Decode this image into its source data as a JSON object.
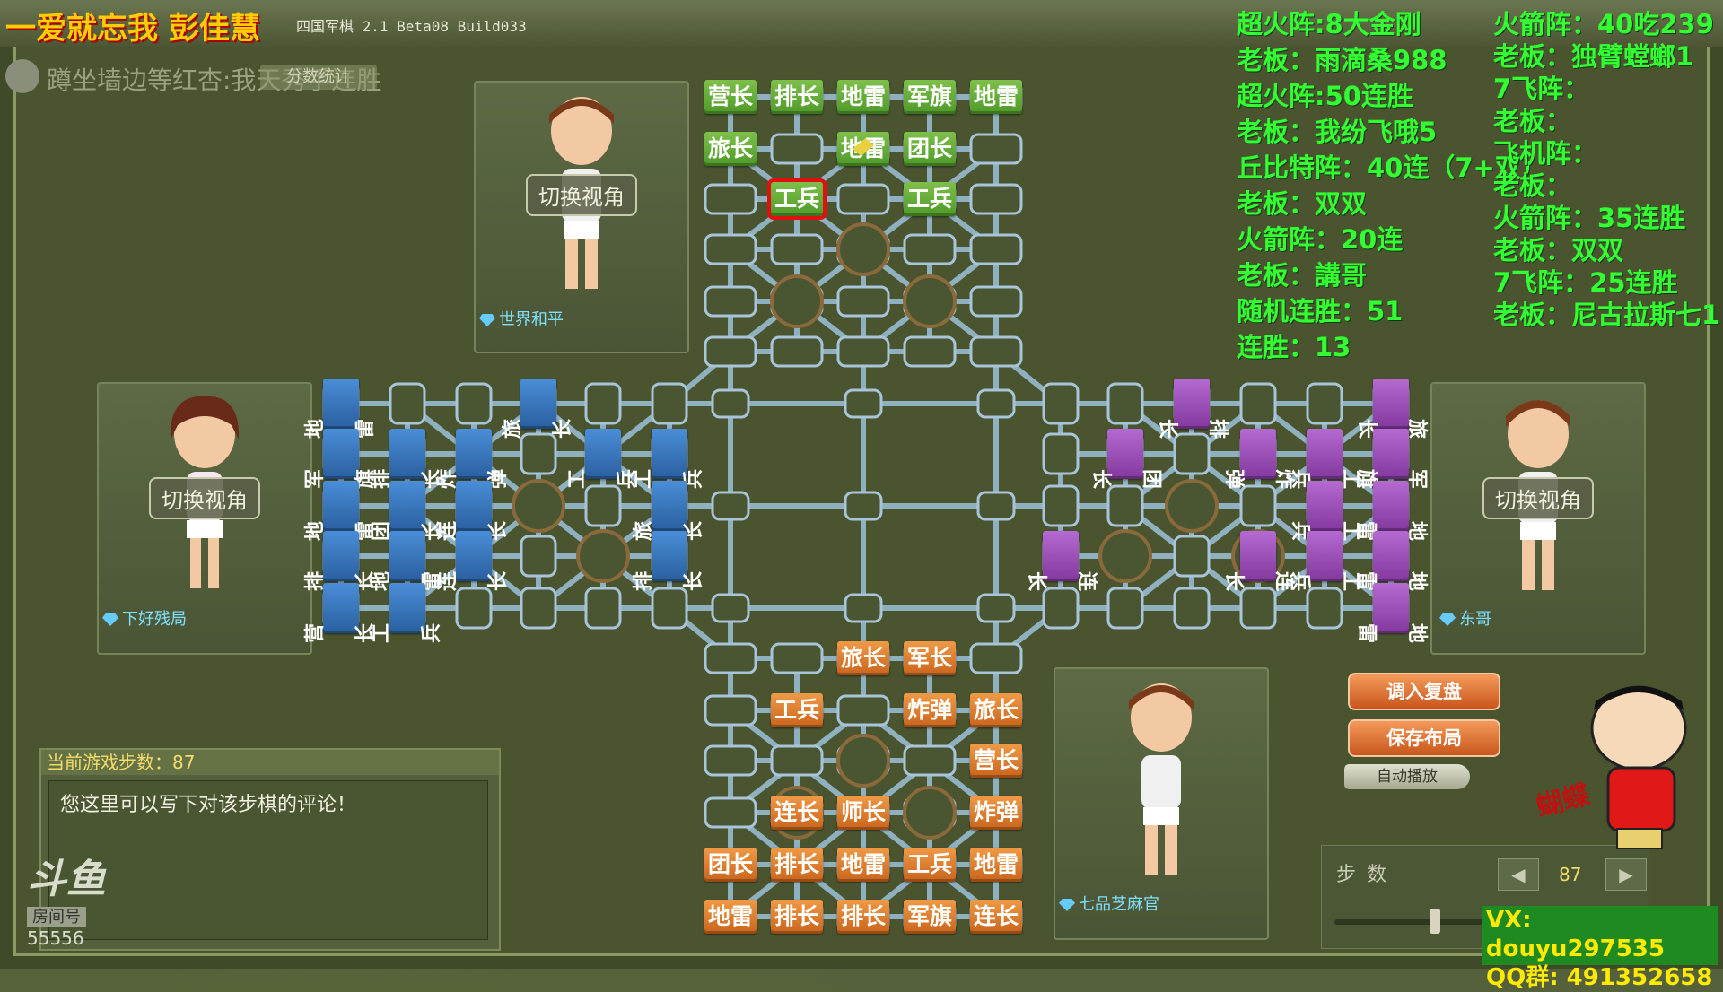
{
  "window": {
    "title": "四国军棋 2.1 Beta08 Build033",
    "overlay_name": "一爱就忘我 彭佳慧",
    "overlay_sub": "蹲坐墙边等红杏:我天秀手连胜",
    "ghost_button": "分数统计"
  },
  "players": {
    "top": {
      "name": "世界和平",
      "switch_label": "切换视角"
    },
    "left": {
      "name": "下好残局",
      "switch_label": "切换视角"
    },
    "right": {
      "name": "东哥",
      "switch_label": "切换视角"
    },
    "bottom": {
      "name": "七品芝麻官"
    }
  },
  "board": {
    "top_pieces": [
      "营长",
      "排长",
      "地雷",
      "军旗",
      "地雷",
      "旅长",
      "",
      "地雷",
      "团长",
      "",
      "工兵",
      "",
      "工兵",
      ""
    ],
    "top_highlight": "工兵",
    "left_pieces": [
      "地雷",
      "军旗",
      "地雷",
      "排长",
      "营长",
      "排长",
      "团长",
      "地雷",
      "工兵",
      "炸弹",
      "连长",
      "连长",
      "旅长",
      "工兵",
      "工兵",
      "旅长",
      "排长"
    ],
    "right_pieces": [
      "排长",
      "旅长",
      "团长",
      "炸弹",
      "工兵",
      "军旗",
      "工兵",
      "地雷",
      "连长",
      "连长",
      "工兵",
      "地雷",
      "地雷"
    ],
    "bottom_pieces": [
      "旅长",
      "军长",
      "工兵",
      "炸弹",
      "旅长",
      "营长",
      "连长",
      "师长",
      "炸弹",
      "团长",
      "排长",
      "地雷",
      "工兵",
      "地雷",
      "地雷",
      "排长",
      "排长",
      "军旗",
      "连长"
    ]
  },
  "info_left": [
    "超火阵:8大金刚",
    "老板：雨滴桑988",
    "超火阵:50连胜",
    "老板：我纷飞哦5",
    "丘比特阵：40连（7+双）",
    "老板：双双",
    "火箭阵：20连",
    "老板：講哥",
    "随机连胜：51",
    "连胜：13"
  ],
  "info_right": [
    "火箭阵：40吃239",
    "老板：独臂螳螂1",
    "7飞阵：",
    "老板：",
    "飞机阵：",
    "老板：",
    "火箭阵：35连胜",
    "老板：双双",
    "7飞阵：25连胜",
    "老板：尼古拉斯七1"
  ],
  "comment": {
    "header": "当前游戏步数：87",
    "body": "您这里可以写下对该步棋的评论！"
  },
  "douyu": {
    "logo": "斗鱼",
    "room_label": "房间号",
    "room_number": "55556"
  },
  "actions": {
    "load_replay": "调入复盘",
    "save_layout": "保存布局",
    "auto_play": "自动播放"
  },
  "steps": {
    "label": "步数",
    "value": "87",
    "slider_fraction": 0.34
  },
  "contact": {
    "vx": "VX: douyu297535",
    "qq": "QQ群: 491352658"
  },
  "sticker_text": "蝴蝶",
  "colors": {
    "green": "#5aa832",
    "purple": "#9a4ab6",
    "blue": "#3a78c0",
    "orange": "#e07a2c",
    "highlight": "#e01010",
    "info_text": "#33ff33"
  }
}
